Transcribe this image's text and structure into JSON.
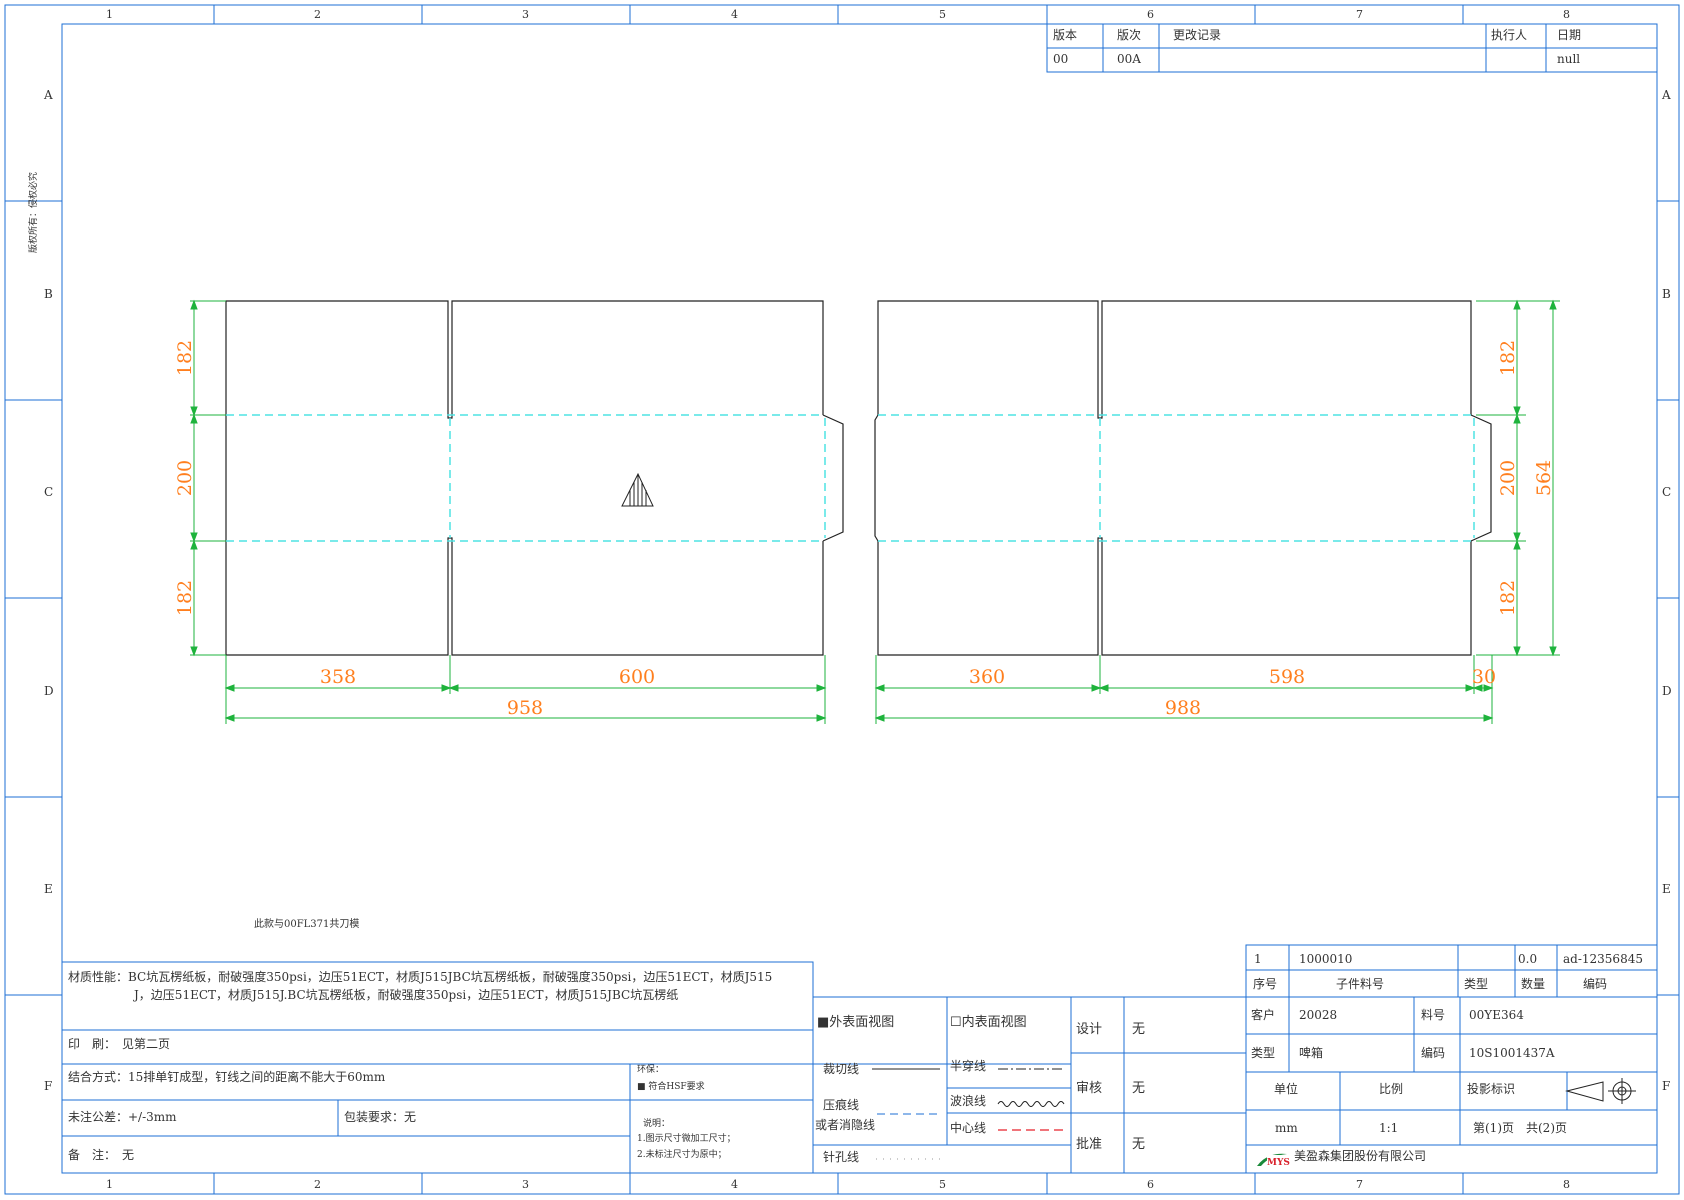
{
  "frame": {
    "col_numbers": [
      "1",
      "2",
      "3",
      "4",
      "5",
      "6",
      "7",
      "8"
    ],
    "row_letters": [
      "A",
      "B",
      "C",
      "D",
      "E",
      "F"
    ],
    "side_note": "版权所有：侵权必究"
  },
  "revision": {
    "headers": {
      "version": "版本",
      "edition": "版次",
      "record": "更改记录",
      "executor": "执行人",
      "date": "日期"
    },
    "row": {
      "version": "00",
      "edition": "00A",
      "record": "",
      "executor": "",
      "date": "null"
    }
  },
  "drawing": {
    "dims": {
      "left_top": "182",
      "left_mid": "200",
      "left_bot": "182",
      "right_top": "182",
      "right_mid": "200",
      "right_bot": "182",
      "right_total": "564",
      "w358": "358",
      "w600": "600",
      "w958": "958",
      "w360": "360",
      "w598": "598",
      "w30": "30",
      "w988": "988"
    },
    "note": "此款与00FL371共刀模"
  },
  "spec": {
    "material": "材质性能：BC坑瓦楞纸板，耐破强度350psi，边压51ECT，材质J515JBC坑瓦楞纸板，耐破强度350psi，边压51ECT，材质J515",
    "material_cont": "J，边压51ECT，材质J515J.BC坑瓦楞纸板，耐破强度350psi，边压51ECT，材质J515JBC坑瓦楞纸",
    "printing": "印　刷：　见第二页",
    "joining": "结合方式：15排单钉成型，钉线之间的距离不能大于60mm",
    "env_title": "环保：",
    "env_value": "■ 符合HSF要求",
    "tolerance": "未注公差：+/-3mm",
    "packing": "包装要求：无",
    "remarks": "备　注：　无",
    "explain_title": "说明：",
    "explain_1": "1.图示尺寸微加工尺寸；",
    "explain_2": "2.未标注尺寸为原中；"
  },
  "legend": {
    "outer_view": "■外表面视图",
    "inner_view": "☐内表面视图",
    "cut": "裁切线",
    "half_cut": "半穿线",
    "crease": "压痕线",
    "crease_2": "或者消隐线",
    "wave": "波浪线",
    "center": "中心线",
    "perforation": "针孔线"
  },
  "approval": {
    "design_label": "设计",
    "design_value": "无",
    "review_label": "审核",
    "review_value": "无",
    "approve_label": "批准",
    "approve_value": "无"
  },
  "title_block": {
    "part_row": {
      "seq": "1",
      "part_no": "1000010",
      "type": "",
      "qty": "0.0",
      "code": "ad-12356845"
    },
    "part_headers": {
      "seq": "序号",
      "part_no": "子件料号",
      "type": "类型",
      "qty": "数量",
      "code": "编码"
    },
    "customer_label": "客户",
    "customer_value": "20028",
    "material_no_label": "料号",
    "material_no_value": "00YE364",
    "type_label": "类型",
    "type_value": "啤箱",
    "code_label": "编码",
    "code_value": "10S1001437A",
    "unit_label": "单位",
    "scale_label": "比例",
    "projection_label": "投影标识",
    "unit_value": "mm",
    "scale_value": "1:1",
    "page_info": "第(1)页　共(2)页",
    "logo_text": "MYS",
    "company": "美盈森集团股份有限公司"
  },
  "colors": {
    "frame": "#1e6fd4",
    "outline": "#222222",
    "crease": "#4fe3e3",
    "dimension_line": "#1eb33c",
    "dimension_text": "#ff7f1e",
    "logo_green": "#1a8a3a",
    "logo_red": "#d9232d"
  }
}
